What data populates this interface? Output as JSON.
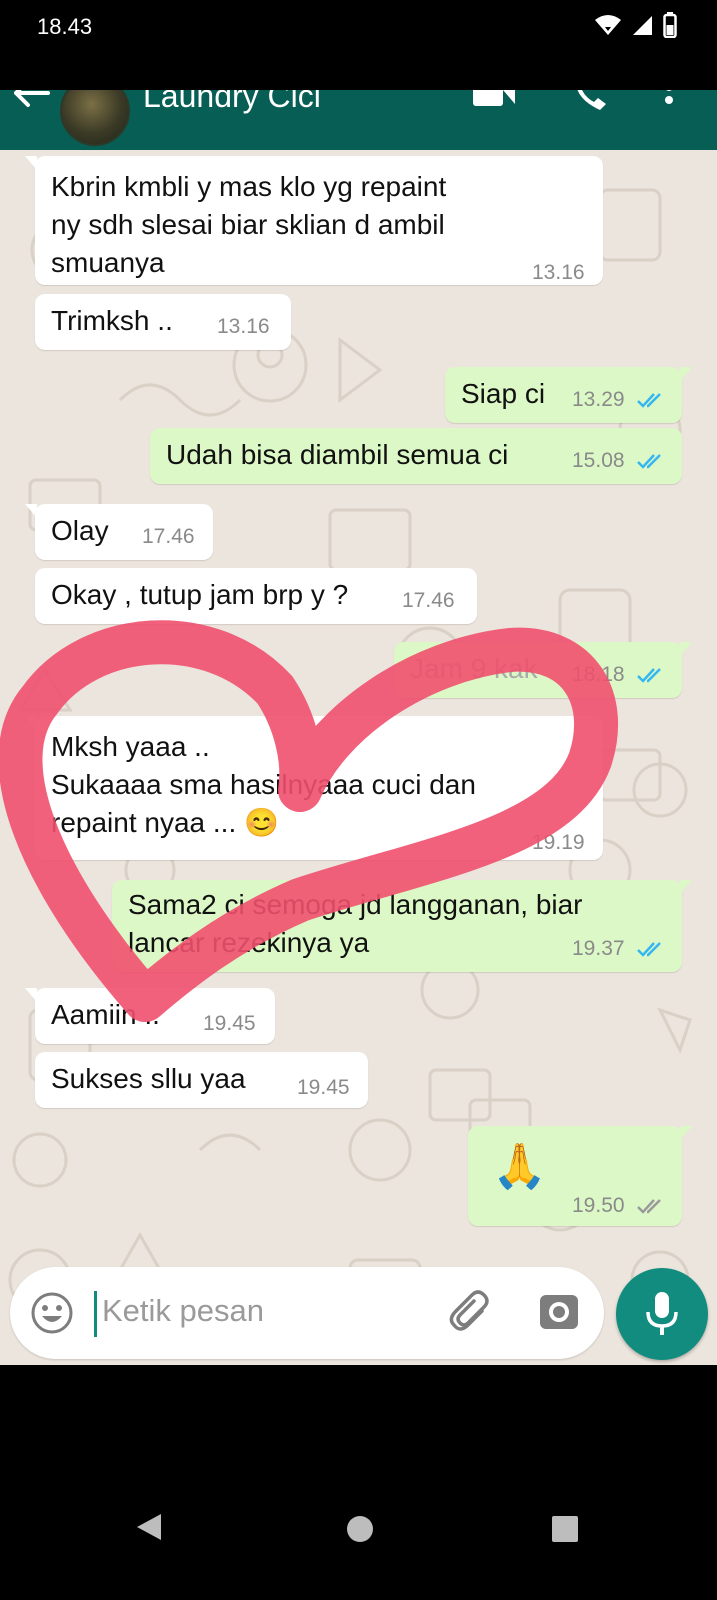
{
  "status_bar": {
    "time": "18.43"
  },
  "header": {
    "contact_name": "Laundry Cici"
  },
  "messages": [
    {
      "dir": "in",
      "text": "Kbrin kmbli y mas klo yg repaint\nny sdh slesai biar sklian d ambil\nsmuanya",
      "time": "13.16"
    },
    {
      "dir": "in",
      "text": "Trimksh ..",
      "time": "13.16"
    },
    {
      "dir": "out",
      "text": "Siap ci",
      "time": "13.29",
      "status": "read"
    },
    {
      "dir": "out",
      "text": "Udah bisa diambil semua ci",
      "time": "15.08",
      "status": "read"
    },
    {
      "dir": "in",
      "text": "Olay",
      "time": "17.46"
    },
    {
      "dir": "in",
      "text": "Okay , tutup jam brp y ?",
      "time": "17.46"
    },
    {
      "dir": "out",
      "text": "Jam 9 kak",
      "time": "18.18",
      "status": "read"
    },
    {
      "dir": "in",
      "text": "Mksh yaaa ..\nSukaaaa sma hasilnyaaa cuci dan\nrepaint nyaa ... 😊",
      "time": "19.19"
    },
    {
      "dir": "out",
      "text": "Sama2 ci semoga jd langganan, biar\nlancar rezekinya ya",
      "time": "19.37",
      "status": "read"
    },
    {
      "dir": "in",
      "text": "Aamiin ..",
      "time": "19.45"
    },
    {
      "dir": "in",
      "text": "Sukses sllu yaa",
      "time": "19.45"
    },
    {
      "dir": "out",
      "text": "🙏",
      "time": "19.50",
      "status": "delivered"
    }
  ],
  "composer": {
    "placeholder": "Ketik pesan"
  },
  "colors": {
    "header": "#075e54",
    "chat_bg": "#ece5dd",
    "outgoing": "#dcf8c6",
    "incoming": "#ffffff",
    "read_tick": "#34b7f1",
    "mic": "#128c7e",
    "heart": "#f0506e"
  },
  "icons": [
    "back-arrow-icon",
    "video-call-icon",
    "phone-icon",
    "more-vert-icon",
    "emoji-icon",
    "attach-icon",
    "camera-icon",
    "mic-icon"
  ]
}
